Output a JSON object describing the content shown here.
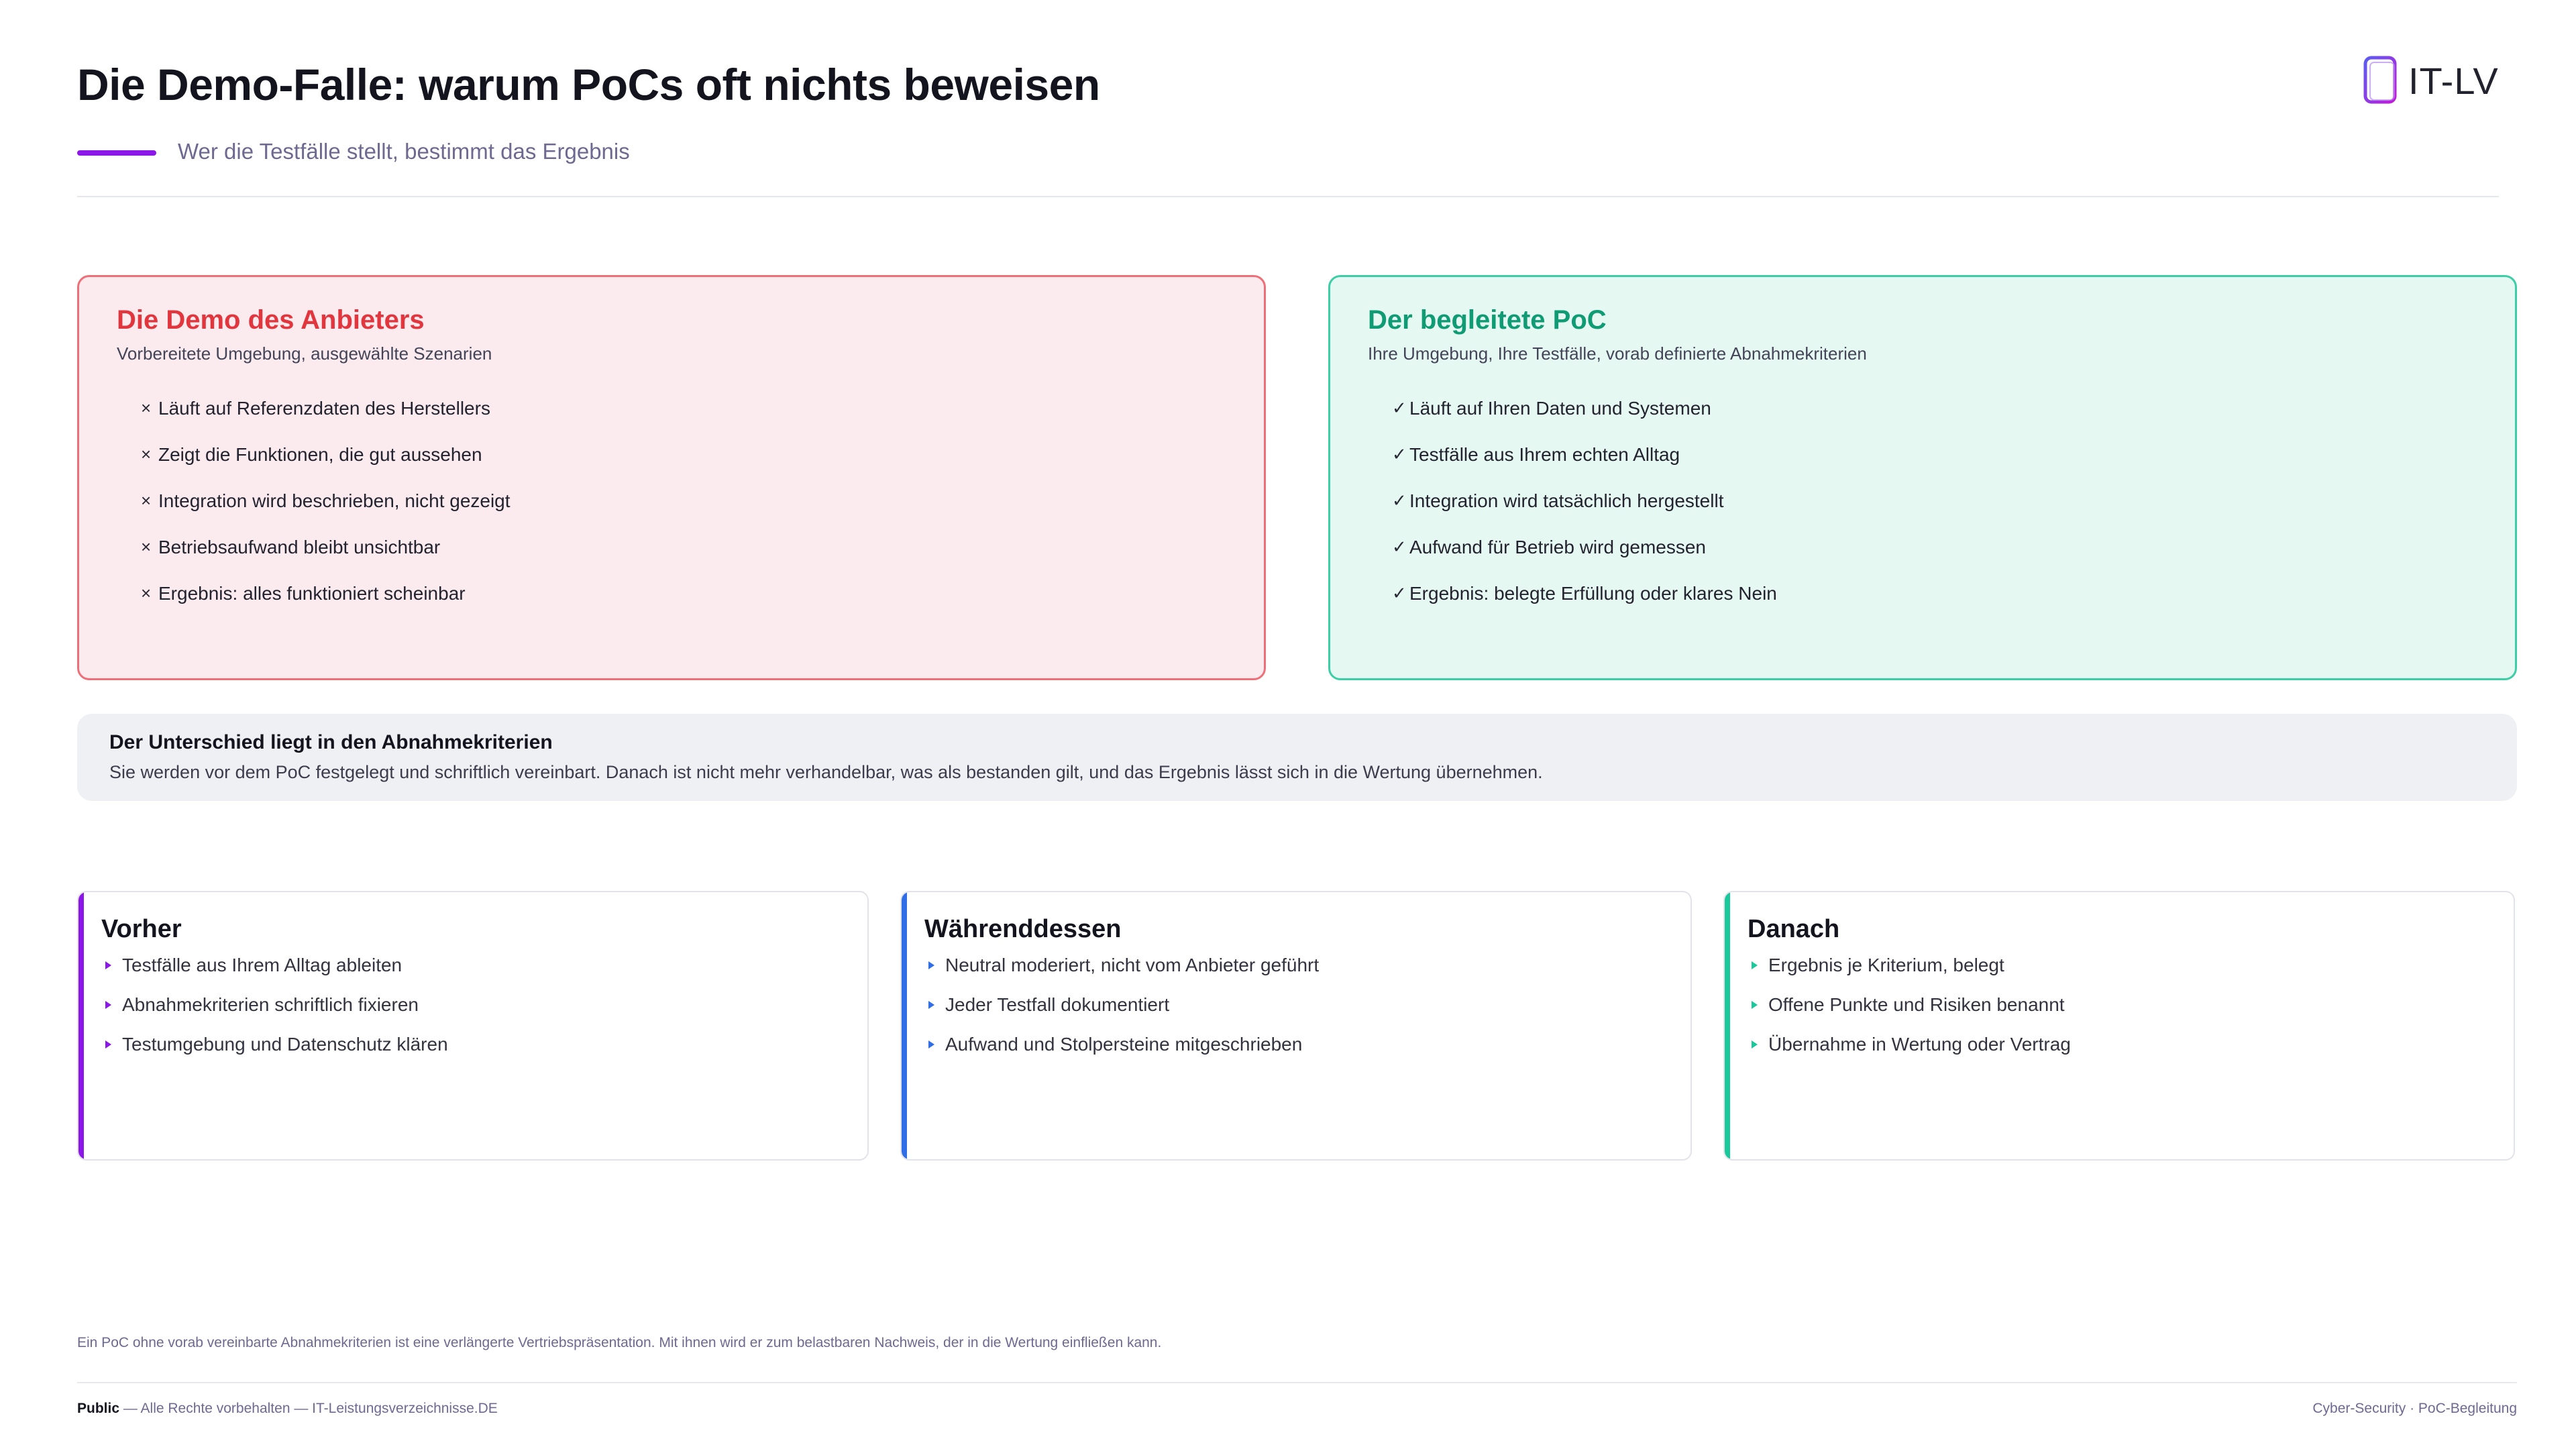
{
  "header": {
    "title": "Die Demo-Falle: warum PoCs oft nichts beweisen",
    "subtitle": "Wer die Testfälle stellt, bestimmt das Ergebnis",
    "logo_text": "IT-LV"
  },
  "compare": {
    "demo": {
      "title": "Die Demo des Anbieters",
      "subtitle": "Vorbereitete Umgebung, ausgewählte Szenarien",
      "marker": "×",
      "items": [
        "Läuft auf Referenzdaten des Herstellers",
        "Zeigt die Funktionen, die gut aussehen",
        "Integration wird beschrieben, nicht gezeigt",
        "Betriebsaufwand bleibt unsichtbar",
        "Ergebnis: alles funktioniert scheinbar"
      ]
    },
    "poc": {
      "title": "Der begleitete PoC",
      "subtitle": "Ihre Umgebung, Ihre Testfälle, vorab definierte Abnahmekriterien",
      "marker": "✓",
      "items": [
        "Läuft auf Ihren Daten und Systemen",
        "Testfälle aus Ihrem echten Alltag",
        "Integration wird tatsächlich hergestellt",
        "Aufwand für Betrieb wird gemessen",
        "Ergebnis: belegte Erfüllung oder klares Nein"
      ]
    }
  },
  "banner": {
    "title": "Der Unterschied liegt in den Abnahmekriterien",
    "text": "Sie werden vor dem PoC festgelegt und schriftlich vereinbart. Danach ist nicht mehr verhandelbar, was als bestanden gilt, und das Ergebnis lässt sich in die Wertung übernehmen."
  },
  "phases": [
    {
      "title": "Vorher",
      "items": [
        "Testfälle aus Ihrem Alltag ableiten",
        "Abnahmekriterien schriftlich fixieren",
        "Testumgebung und Datenschutz klären"
      ]
    },
    {
      "title": "Währenddessen",
      "items": [
        "Neutral moderiert, nicht vom Anbieter geführt",
        "Jeder Testfall dokumentiert",
        "Aufwand und Stolpersteine mitgeschrieben"
      ]
    },
    {
      "title": "Danach",
      "items": [
        "Ergebnis je Kriterium, belegt",
        "Offene Punkte und Risiken benannt",
        "Übernahme in Wertung oder Vertrag"
      ]
    }
  ],
  "footer": {
    "note": "Ein PoC ohne vorab vereinbarte Abnahmekriterien ist eine verlängerte Vertriebspräsentation. Mit ihnen wird er zum belastbaren Nachweis, der in die Wertung einfließen kann.",
    "classification": "Public",
    "rights": " — Alle Rechte vorbehalten — IT-Leistungsverzeichnisse.DE",
    "right_text": "Cyber-Security · PoC-Begleitung"
  },
  "colors": {
    "accent": "#8b17e8",
    "demo": "#e2363f",
    "poc": "#0f9b73",
    "phase_before": "#8b17e8",
    "phase_during": "#2f6ee6",
    "phase_after": "#19c89b"
  }
}
